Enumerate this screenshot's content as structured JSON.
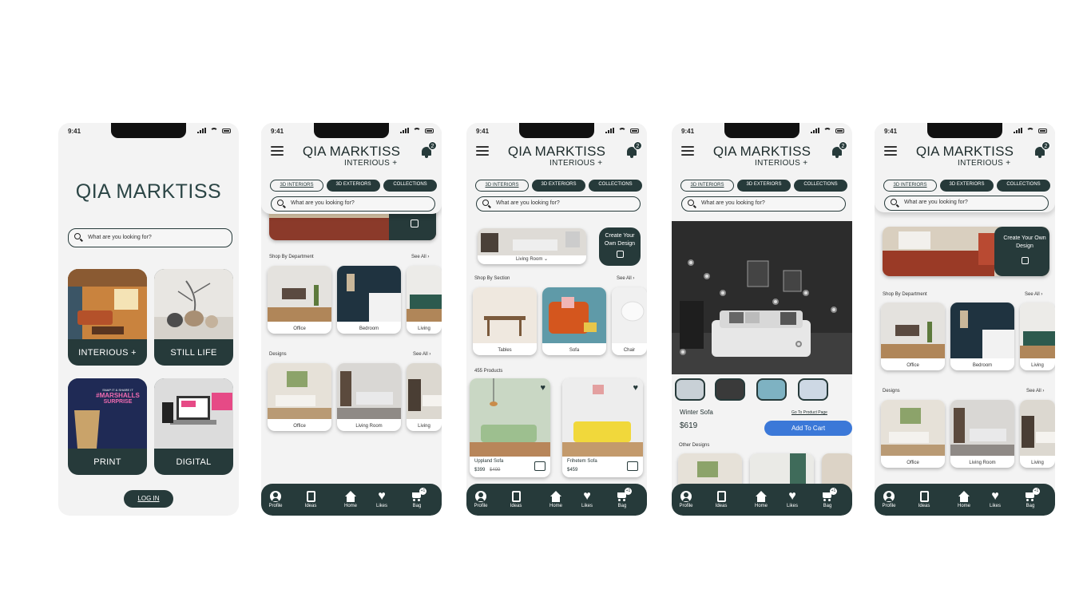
{
  "status": {
    "time": "9:41"
  },
  "brand": {
    "name": "QIA MARKTISS",
    "sub": "INTERIOUS +"
  },
  "notif_count": "2",
  "search_placeholder": "What are you looking for?",
  "tabs": [
    "3D INTERIORS",
    "3D EXTERIORS",
    "COLLECTIONS"
  ],
  "nav": [
    {
      "label": "Profile",
      "icon": "profile-icon"
    },
    {
      "label": "Ideas",
      "icon": "ideas-icon"
    },
    {
      "label": "Home",
      "icon": "home-icon"
    },
    {
      "label": "Likes",
      "icon": "heart-icon"
    },
    {
      "label": "Bag",
      "icon": "cart-icon"
    }
  ],
  "bag_count": "+1",
  "screen1": {
    "title": "QIA MARKTISS",
    "tiles": [
      "INTERIOUS +",
      "STILL LIFE",
      "PRINT",
      "DIGITAL"
    ],
    "print_promo": {
      "line1": "SNAP IT & SHARE IT",
      "line2": "#MARSHALLS",
      "line3": "SURPRISE"
    },
    "login": "LOG IN"
  },
  "screen2": {
    "shop_by_department": "Shop By Department",
    "see_all": "See All",
    "departments": [
      "Office",
      "Bedroom",
      "Living"
    ],
    "designs_title": "Designs",
    "designs": [
      "Office",
      "Living Room",
      "Living"
    ]
  },
  "screen3": {
    "room_label": "Living Room",
    "create_design": "Create Your Own Design",
    "shop_by_section": "Shop By Section",
    "see_all": "See All",
    "sections": [
      "Tables",
      "Sofa",
      "Chair"
    ],
    "products_count": "455 Products",
    "products": [
      {
        "name": "Uppland Sofa",
        "price": "$399",
        "old_price": "$499"
      },
      {
        "name": "Frihetem Sofa",
        "price": "$459"
      }
    ]
  },
  "screen4": {
    "product": "Winter Sofa",
    "price": "$619",
    "go_to_product": "Go To Product Page",
    "add_to_cart": "Add To Cart",
    "other_designs": "Other Designs",
    "accent": "#3b78d8"
  },
  "screen5": {
    "create_design": "Create Your Own Design",
    "shop_by_department": "Shop By Department",
    "see_all": "See All",
    "departments": [
      "Office",
      "Bedroom",
      "Living"
    ],
    "designs_title": "Designs",
    "designs": [
      "Office",
      "Living Room",
      "Living"
    ]
  },
  "colors": {
    "primary": "#263a3a",
    "background": "#f3f3f3"
  }
}
